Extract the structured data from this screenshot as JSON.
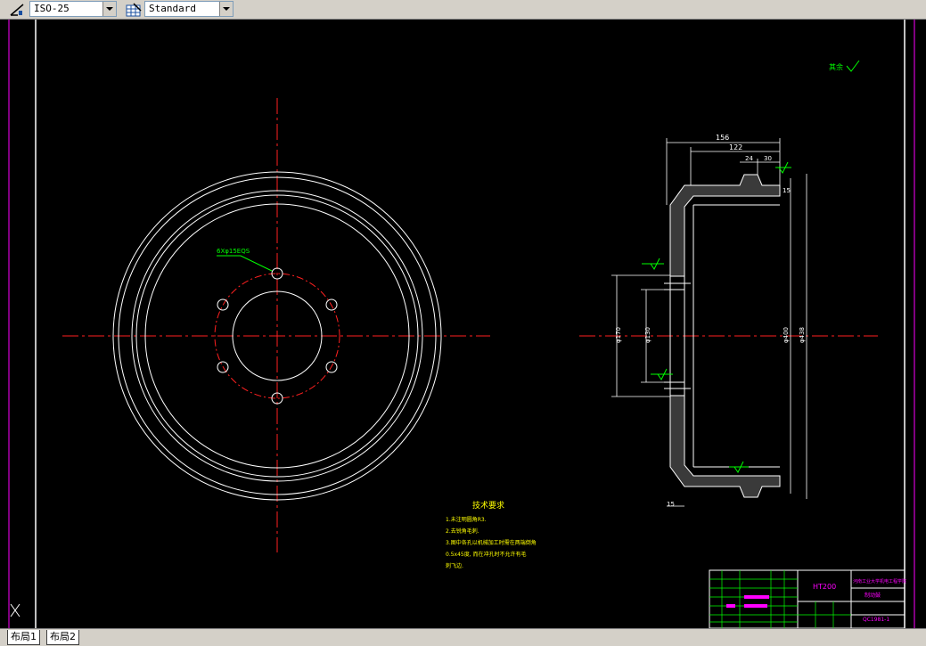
{
  "toolbar": {
    "dimstyle_value": "ISO-25",
    "tablestyle_value": "Standard",
    "dimstyle_icon": "dimension-style-icon",
    "tablestyle_icon": "table-style-icon"
  },
  "drawing": {
    "roughness_note": "其余",
    "hole_callout": "6Xφ15EQS",
    "dim_overall_depth": "156",
    "dim_depth_2": "122",
    "dim_24": "24",
    "dim_30": "30",
    "dim_15_top": "15",
    "dim_15_bottom": "15",
    "dim_d_pcd": "φ170",
    "dim_d_bore": "φ130",
    "dim_d_drum": "φ400",
    "dim_d_outer": "φ438",
    "tech_title": "技术要求",
    "tech_lines": [
      "1.未注明圆角R3.",
      "2.去锐角毛刺.",
      "3.图中各孔以机械加工时需在两端倒角",
      "  0.5x45度, 而在冲孔时不允许有毛",
      "  刺飞边."
    ]
  },
  "title_block": {
    "material": "HT200",
    "school": "河南工业大学机电工程学院",
    "part_name": "制动鼓",
    "drawing_no": "QC1981-1"
  },
  "tabs": [
    "布局1",
    "布局2"
  ],
  "colors": {
    "background": "#000000",
    "line_white": "#ffffff",
    "center_line": "#ff2020",
    "text_yellow": "#ffff00",
    "text_green": "#00ff00",
    "frame_magenta": "#ff00ff"
  }
}
